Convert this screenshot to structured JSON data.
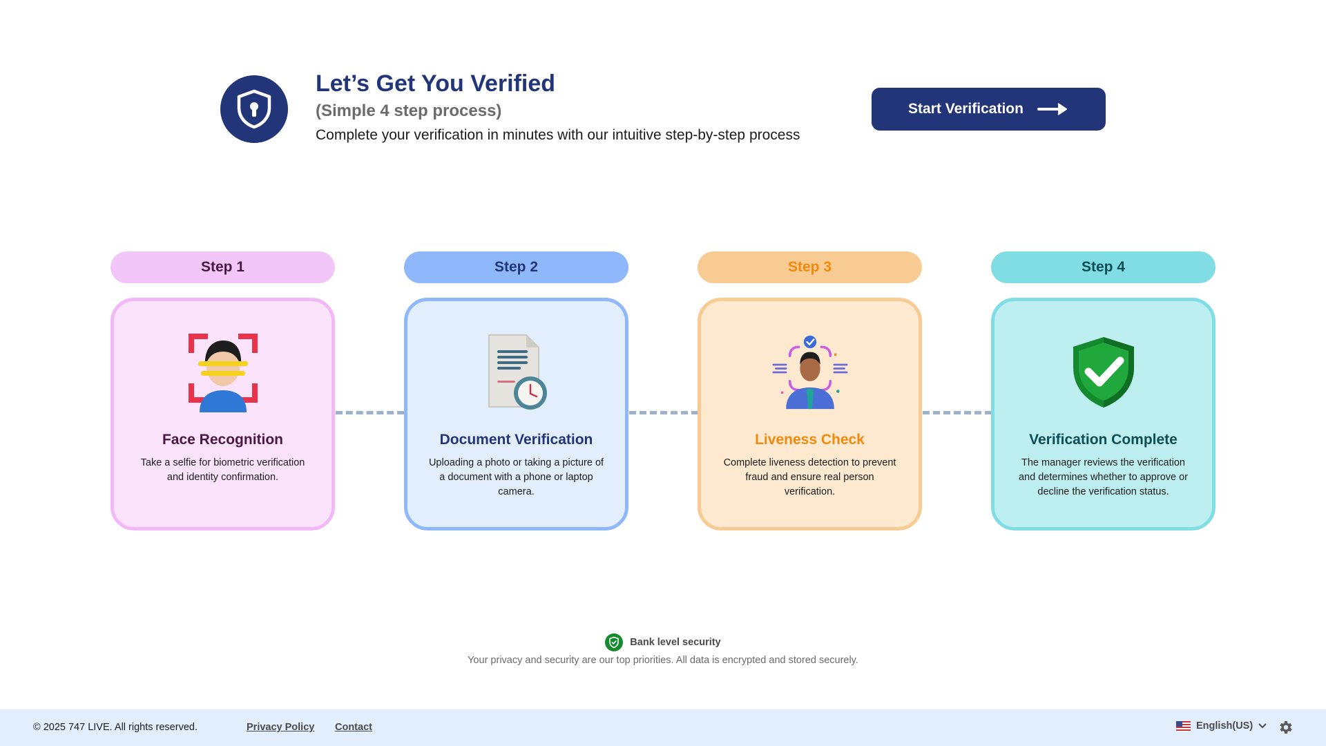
{
  "header": {
    "title": "Let’s Get You Verified",
    "subtitle": "(Simple 4 step process)",
    "description": "Complete your verification in minutes with our intuitive step-by-step process",
    "start_button_label": "Start Verification"
  },
  "steps": [
    {
      "pill": "Step 1",
      "title": "Face Recognition",
      "description": "Take a selfie for biometric verification and identity confirmation.",
      "icon": "face-scan-icon",
      "colors": {
        "pill_bg": "#f2c6f9",
        "pill_text": "#4a1642",
        "card_bg": "#fbe3fc",
        "card_border": "#f3b8f7",
        "title": "#4a1642"
      }
    },
    {
      "pill": "Step 2",
      "title": "Document Verification",
      "description": "Uploading a photo or taking a picture of a document with a phone or laptop camera.",
      "icon": "document-clock-icon",
      "colors": {
        "pill_bg": "#8fb8fa",
        "pill_text": "#223578",
        "card_bg": "#e3eefc",
        "card_border": "#8fb8fa",
        "title": "#223578"
      }
    },
    {
      "pill": "Step 3",
      "title": "Liveness Check",
      "description": "Complete liveness detection to prevent fraud and ensure real person verification.",
      "icon": "liveness-person-icon",
      "colors": {
        "pill_bg": "#f8cb92",
        "pill_text": "#f08a0e",
        "card_bg": "#fde9d0",
        "card_border": "#f8cb92",
        "title": "#f08a0e"
      }
    },
    {
      "pill": "Step 4",
      "title": "Verification Complete",
      "description": "The manager reviews the verification and determines whether to approve or decline the verification status.",
      "icon": "shield-check-icon",
      "colors": {
        "pill_bg": "#80dde3",
        "pill_text": "#0c4e55",
        "card_bg": "#bdeef0",
        "card_border": "#80dde3",
        "title": "#0c4e55"
      }
    }
  ],
  "security": {
    "label": "Bank level security",
    "description": "Your privacy and security are our top priorities. All data is encrypted and stored securely."
  },
  "footer": {
    "copyright": "© 2025 747 LIVE. All rights reserved.",
    "links": [
      "Privacy Policy",
      "Contact"
    ],
    "language": "English(US)"
  },
  "colors": {
    "brand": "#223578",
    "footer_bg": "#e3eefc",
    "connector": "#9cb1cc",
    "security_green": "#138a2d"
  }
}
